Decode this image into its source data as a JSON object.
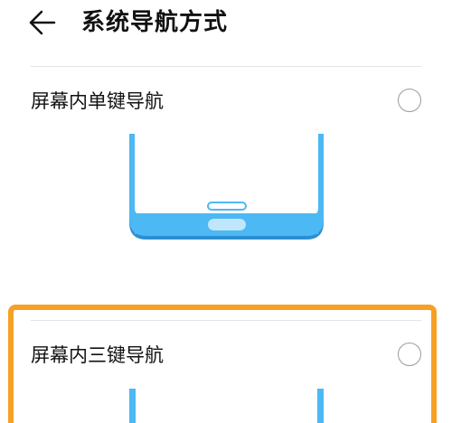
{
  "header": {
    "back_icon": "arrow-left-icon",
    "title": "系统导航方式"
  },
  "options": [
    {
      "label": "屏幕内单键导航",
      "selected": false,
      "illustration": "single-key-navigation-illustration"
    },
    {
      "label": "屏幕内三键导航",
      "selected": false,
      "highlighted": true,
      "illustration": "three-key-navigation-illustration"
    }
  ],
  "colors": {
    "phone_blue": "#4cb8f4",
    "phone_blue_dark": "#2c8fd0",
    "highlight_orange": "#f6a126",
    "radio_border": "#9a9a9a",
    "divider": "#e3e3e3"
  }
}
